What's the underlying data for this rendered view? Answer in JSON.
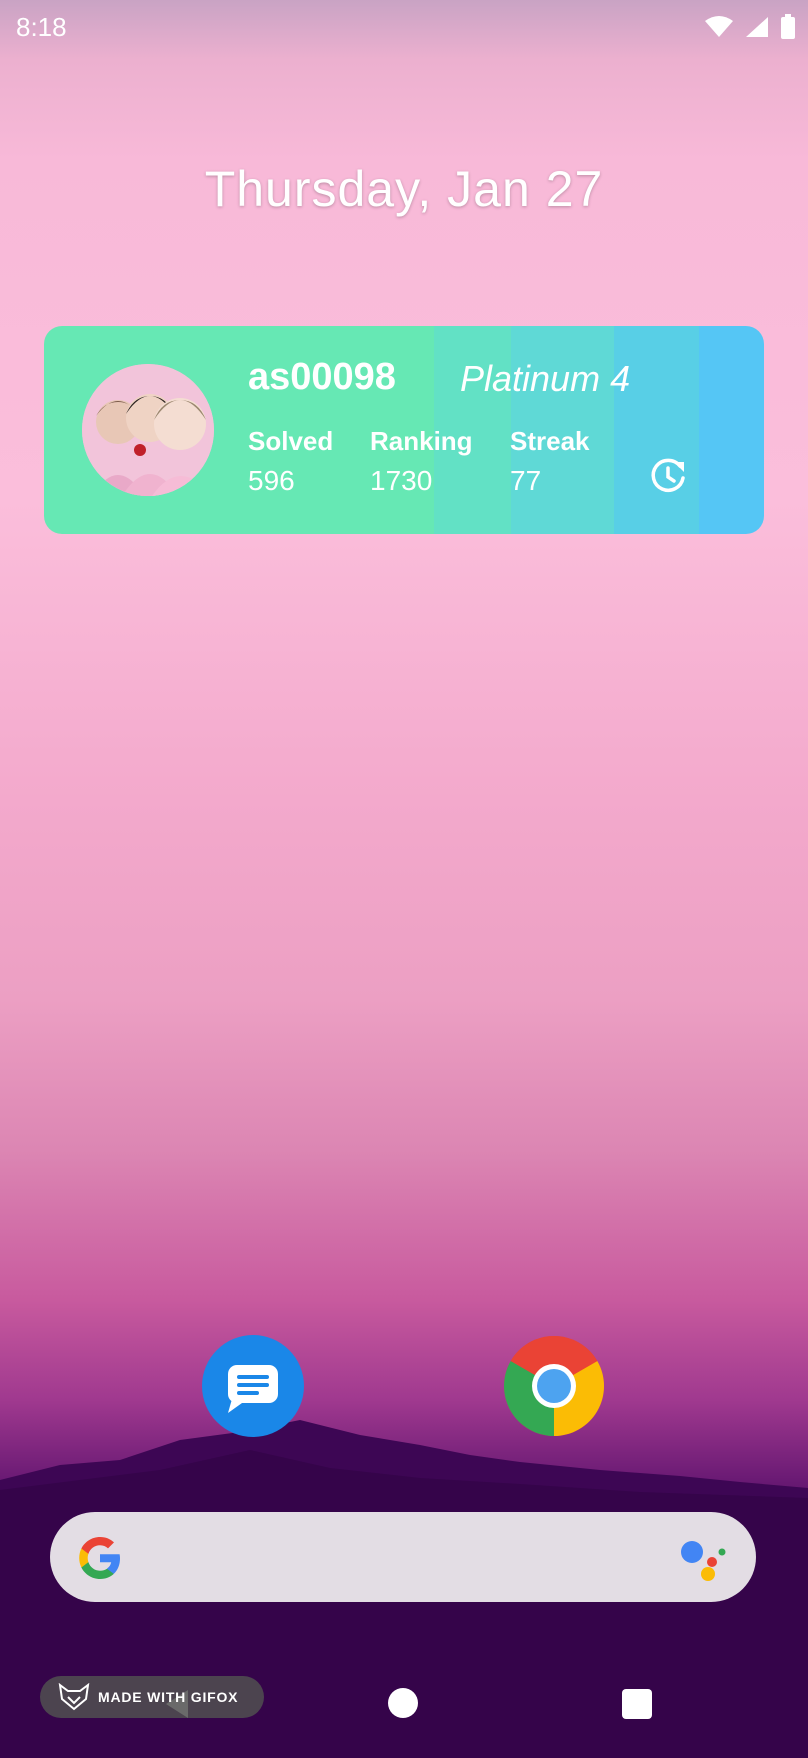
{
  "status_bar": {
    "time": "8:18",
    "icons": [
      "wifi-icon",
      "signal-icon",
      "battery-icon"
    ]
  },
  "lockscreen": {
    "date": "Thursday, Jan 27"
  },
  "widget": {
    "handle": "as00098",
    "tier": "Platinum 4",
    "stats": [
      {
        "label": "Solved",
        "value": "596"
      },
      {
        "label": "Ranking",
        "value": "1730"
      },
      {
        "label": "Streak",
        "value": "77"
      }
    ],
    "colors": {
      "green": "#66e8b4",
      "blue": "#55c6f5"
    },
    "refresh_icon": "refresh-clock-icon"
  },
  "dock": {
    "apps": [
      "Messages",
      "Chrome"
    ]
  },
  "search_bar": {
    "logo": "google-g-icon",
    "assistant": "google-assistant-icon"
  },
  "watermark": {
    "text": "MADE WITH GIFOX"
  },
  "nav_bar": {
    "buttons": [
      "back",
      "home",
      "recents"
    ]
  }
}
